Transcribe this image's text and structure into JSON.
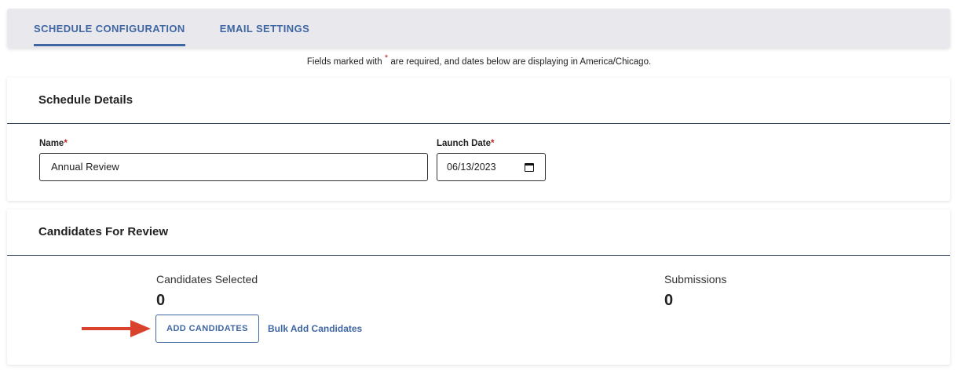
{
  "tabs": [
    {
      "label": "SCHEDULE CONFIGURATION",
      "active": true
    },
    {
      "label": "EMAIL SETTINGS",
      "active": false
    }
  ],
  "notice": {
    "before": "Fields marked with",
    "star": "*",
    "after": "are required, and dates below are displaying in America/Chicago."
  },
  "schedule_details": {
    "title": "Schedule Details",
    "name_label": "Name",
    "name_value": "Annual Review",
    "launch_label": "Launch Date",
    "launch_value": "06/13/2023",
    "required_star": "*"
  },
  "candidates": {
    "title": "Candidates For Review",
    "selected_label": "Candidates Selected",
    "selected_value": "0",
    "submissions_label": "Submissions",
    "submissions_value": "0",
    "add_button": "ADD CANDIDATES",
    "bulk_link": "Bulk Add Candidates"
  },
  "colors": {
    "accent": "#3e66a3",
    "required": "#b3261e",
    "arrow": "#d9432e"
  }
}
